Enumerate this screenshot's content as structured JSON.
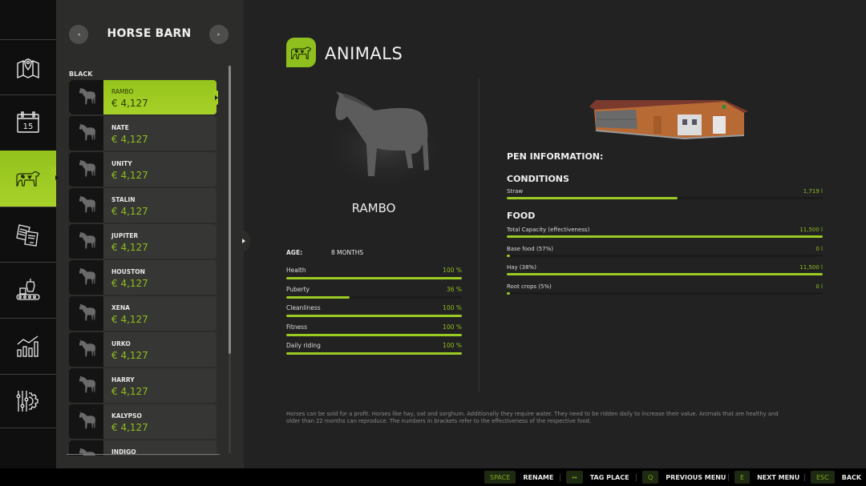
{
  "nav": {
    "items": [
      {
        "name": "map",
        "icon": "map-icon",
        "active": false
      },
      {
        "name": "calendar",
        "icon": "calendar-icon",
        "label": "15",
        "active": false
      },
      {
        "name": "animals",
        "icon": "cow-icon",
        "active": true
      },
      {
        "name": "contracts",
        "icon": "documents-icon",
        "active": false
      },
      {
        "name": "production",
        "icon": "production-icon",
        "active": false
      },
      {
        "name": "statistics",
        "icon": "chart-icon",
        "active": false
      },
      {
        "name": "settings",
        "icon": "settings-icon",
        "active": false
      }
    ]
  },
  "list_panel": {
    "title": "HORSE BARN",
    "prev_icon": "◂",
    "next_icon": "▸",
    "group_label": "BLACK",
    "items": [
      {
        "name": "RAMBO",
        "price": "€ 4,127",
        "selected": true
      },
      {
        "name": "NATE",
        "price": "€ 4,127"
      },
      {
        "name": "UNITY",
        "price": "€ 4,127"
      },
      {
        "name": "STALIN",
        "price": "€ 4,127"
      },
      {
        "name": "JUPITER",
        "price": "€ 4,127"
      },
      {
        "name": "HOUSTON",
        "price": "€ 4,127"
      },
      {
        "name": "XENA",
        "price": "€ 4,127"
      },
      {
        "name": "URKO",
        "price": "€ 4,127"
      },
      {
        "name": "HARRY",
        "price": "€ 4,127"
      },
      {
        "name": "KALYPSO",
        "price": "€ 4,127"
      },
      {
        "name": "INDIGO",
        "price": ""
      }
    ]
  },
  "page": {
    "title": "ANIMALS",
    "icon": "cow-icon"
  },
  "animal": {
    "name": "RAMBO",
    "age_label": "AGE:",
    "age_value": "8 MONTHS",
    "stats": [
      {
        "label": "Health",
        "value": "100 %",
        "fraction": 1.0
      },
      {
        "label": "Puberty",
        "value": "36 %",
        "fraction": 0.36
      },
      {
        "label": "Cleanliness",
        "value": "100 %",
        "fraction": 1.0
      },
      {
        "label": "Fitness",
        "value": "100 %",
        "fraction": 1.0
      },
      {
        "label": "Daily riding",
        "value": "100 %",
        "fraction": 1.0
      }
    ]
  },
  "pen": {
    "title": "PEN INFORMATION:",
    "conditions_title": "CONDITIONS",
    "conditions": [
      {
        "label": "Straw",
        "value": "1,719 l",
        "fraction": 0.54
      }
    ],
    "food_title": "FOOD",
    "food": [
      {
        "label": "Total Capacity (effectiveness)",
        "value": "11,500 l",
        "fraction": 1.0
      },
      {
        "label": "Base food (57%)",
        "value": "0 l",
        "fraction": 0.0
      },
      {
        "label": "Hay (38%)",
        "value": "11,500 l",
        "fraction": 1.0
      },
      {
        "label": "Root crops (5%)",
        "value": "0 l",
        "fraction": 0.0
      }
    ]
  },
  "description": "Horses can be sold for a profit. Horses like hay, oat and sorghum. Additionally they require water. They need to be ridden daily to increase their value. Animals that are healthy and older than 22 months can reproduce. The numbers in brackets refer to the effectiveness of the respective food.",
  "footer": {
    "buttons": [
      {
        "key": "SPACE",
        "label": "RENAME"
      },
      {
        "key": "↔",
        "label": "TAG PLACE"
      },
      {
        "key": "Q",
        "label": "PREVIOUS MENU"
      },
      {
        "key": "E",
        "label": "NEXT MENU"
      },
      {
        "key": "ESC",
        "label": "BACK"
      }
    ]
  },
  "colors": {
    "accent": "#9acb22",
    "accent_text": "#8fbd1f",
    "panel": "#2c2d2a",
    "background": "#222222"
  }
}
